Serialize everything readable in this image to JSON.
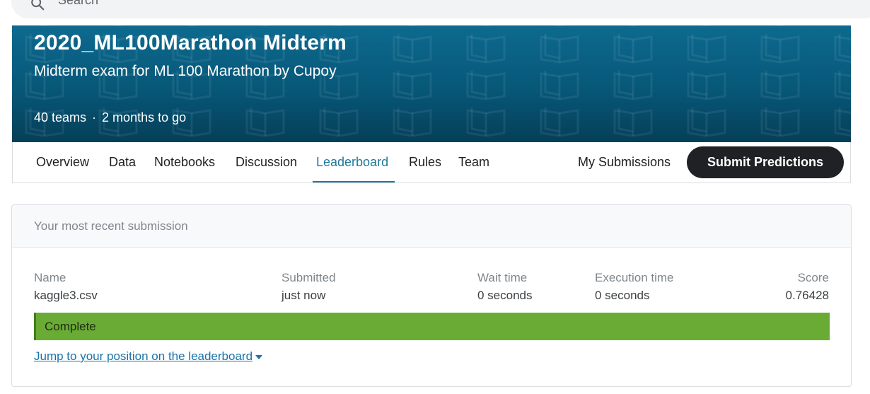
{
  "search": {
    "placeholder": "Search",
    "icon": "search-icon"
  },
  "competition": {
    "title": "2020_ML100Marathon Midterm",
    "subtitle": "Midterm exam for ML 100 Marathon by Cupoy",
    "teams": "40 teams",
    "separator": "·",
    "deadline": "2 months to go",
    "banner_color": "#075778"
  },
  "tabs": [
    {
      "label": "Overview",
      "active": false
    },
    {
      "label": "Data",
      "active": false
    },
    {
      "label": "Notebooks",
      "active": false
    },
    {
      "label": "Discussion",
      "active": false
    },
    {
      "label": "Leaderboard",
      "active": true
    },
    {
      "label": "Rules",
      "active": false
    },
    {
      "label": "Team",
      "active": false
    }
  ],
  "actions": {
    "my_submissions": "My Submissions",
    "submit_predictions": "Submit Predictions"
  },
  "submission": {
    "header": "Your most recent submission",
    "columns": {
      "name": "Name",
      "submitted": "Submitted",
      "wait_time": "Wait time",
      "execution_time": "Execution time",
      "score": "Score"
    },
    "values": {
      "name": "kaggle3.csv",
      "submitted": "just now",
      "wait_time": "0 seconds",
      "execution_time": "0 seconds",
      "score": "0.76428"
    },
    "status": "Complete",
    "status_color": "#6aab36",
    "jump_link": "Jump to your position on the leaderboard"
  },
  "colors": {
    "accent": "#20799c",
    "link": "#1a73a8",
    "button": "#202124"
  }
}
